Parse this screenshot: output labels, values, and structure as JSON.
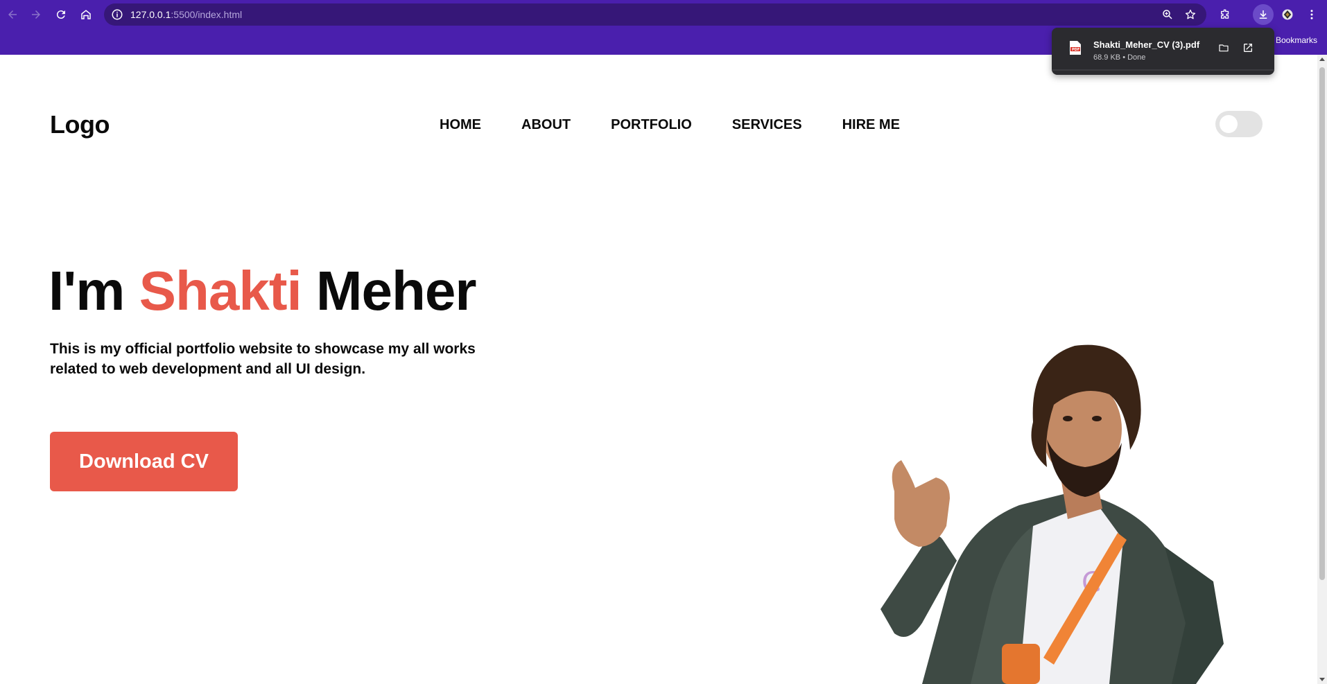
{
  "browser": {
    "url_host": "127.0.0.1",
    "url_rest": ":5500/index.html",
    "bookmarks_label": "Bookmarks",
    "toolbar_icons": [
      "back-icon",
      "forward-icon",
      "reload-icon",
      "home-icon",
      "site-info-icon",
      "zoom-icon",
      "star-icon",
      "extensions-icon",
      "download-icon",
      "profile-icon",
      "menu-icon"
    ],
    "theme_color": "#4a1fad"
  },
  "download": {
    "filename": "Shakti_Meher_CV (3).pdf",
    "meta": "68.9 KB • Done",
    "actions": [
      "folder-icon",
      "open-external-icon"
    ]
  },
  "site": {
    "logo": "Logo",
    "nav": [
      "HOME",
      "ABOUT",
      "PORTFOLIO",
      "SERVICES",
      "HIRE ME"
    ],
    "theme_toggle_on": false,
    "hero": {
      "prefix": "I'm ",
      "name_accent": "Shakti",
      "suffix": " Meher",
      "description": "This is my official portfolio website to showcase my all works related to web development and all UI design.",
      "cta": "Download CV"
    },
    "accent_color": "#e8594a"
  }
}
